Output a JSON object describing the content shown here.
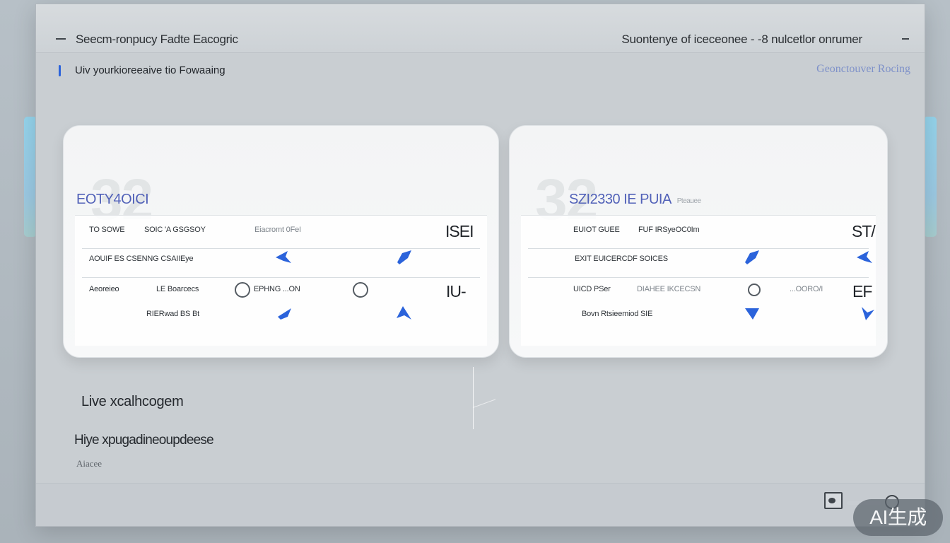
{
  "window": {
    "title": "Seecm-ronpucy Fadte Eacogric",
    "status": "Suontenye of iceceonee  -  -8 nulcetlor onrumer"
  },
  "subheader": {
    "text": "Uiv yourkioreeaive tio Fowaaing",
    "link": "Geonctouver Rocing"
  },
  "cards": {
    "left": {
      "ghost_number": "32",
      "title": "EOTY4OICI",
      "rows": [
        {
          "c1": "TO SOWE",
          "c2": "SOIC 'A GSGSOY",
          "c3": "Eiacromt 0FeI",
          "c4": "ISEI"
        },
        {
          "c1": "AOUIF ES CSENNG CSAIIEye"
        },
        {
          "c1": "Aeoreieo",
          "c2": "LE Boarcecs",
          "c3": "EPHNG ...ON",
          "c4": "IU-"
        },
        {
          "c1": "RIERwad BS Bt"
        }
      ]
    },
    "right": {
      "ghost_number": "32",
      "title": "SZI2330 IE PUIA",
      "title_small": "Pteauee",
      "rows": [
        {
          "c1": "EUIOT GUEE",
          "c2": "FUF IRSyeOC0Im",
          "c4": "ST/"
        },
        {
          "c1": "EXIT EUICERCDF SOICES"
        },
        {
          "c1": "UICD PSer",
          "c2": "DIAHEE IKCECSN",
          "c3": "...OORO/I",
          "c4": "EF"
        },
        {
          "c1": "Bovn Rtsieemiod SIE"
        }
      ]
    }
  },
  "lower": {
    "title": "Live xcalhcogem",
    "subtitle": "Hiye xpugadineoupdeese",
    "meta": "Aiacee"
  },
  "watermark": "AI生成",
  "icons": {
    "arrow": "arrow-icon",
    "ring": "ring-icon",
    "menu": "menu-dash-icon",
    "minimize": "minimize-icon",
    "footer_button": "camera-icon",
    "footer_ring": "refresh-icon"
  },
  "colors": {
    "accent": "#2b63db",
    "title_blue": "#5161b8",
    "link_blue": "#7e91c9"
  }
}
